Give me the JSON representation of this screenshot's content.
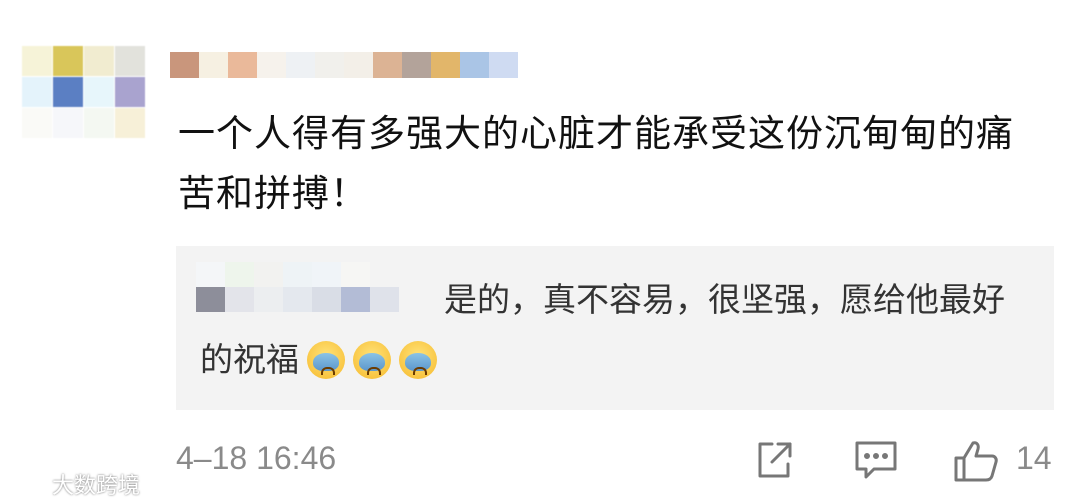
{
  "comment": {
    "text": "一个人得有多强大的心脏才能承受这份沉甸甸的痛苦和拼搏！",
    "timestamp": "4–18 16:46",
    "like_count": "14"
  },
  "reply": {
    "text": "是的，真不容易，很坚强，愿给他最好的祝福",
    "emoji_count": 3,
    "emoji_icon": "crying-face-icon"
  },
  "watermark": {
    "text": "大数跨境"
  },
  "colors": {
    "reply_background": "#f3f3f3",
    "meta_text": "#8a8a8a",
    "icon_stroke": "#777777"
  }
}
